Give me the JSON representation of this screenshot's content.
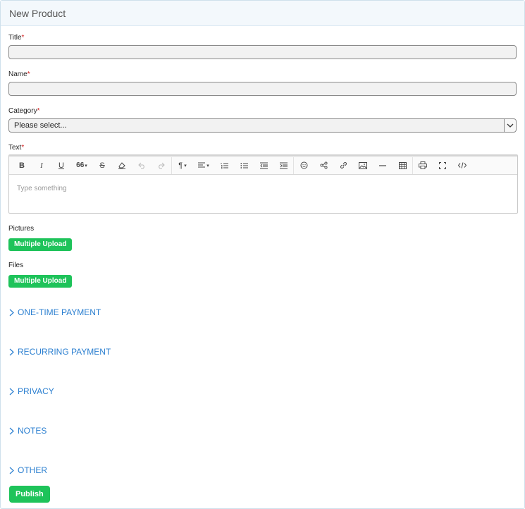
{
  "header": {
    "title": "New Product"
  },
  "fields": {
    "title": {
      "label": "Title",
      "required": "*",
      "value": ""
    },
    "name": {
      "label": "Name",
      "required": "*",
      "value": ""
    },
    "category": {
      "label": "Category",
      "required": "*",
      "selected": "Please select..."
    },
    "text": {
      "label": "Text",
      "required": "*",
      "placeholder": "Type something"
    }
  },
  "toolbar": {
    "buttons": [
      "bold-icon",
      "italic-icon",
      "underline-icon",
      "quote-icon",
      "strikethrough-icon",
      "eraser-icon",
      "undo-icon",
      "redo-icon",
      "paragraph-icon",
      "align-icon",
      "ordered-list-icon",
      "unordered-list-icon",
      "outdent-icon",
      "indent-icon",
      "emoji-icon",
      "share-icon",
      "link-icon",
      "image-icon",
      "horizontal-rule-icon",
      "table-icon",
      "print-icon",
      "fullscreen-icon",
      "code-icon"
    ],
    "glyphs": {
      "bold": "B",
      "italic": "I",
      "underline": "U",
      "quote": "66",
      "strike": "S"
    }
  },
  "pictures": {
    "label": "Pictures",
    "button": "Multiple Upload"
  },
  "files": {
    "label": "Files",
    "button": "Multiple Upload"
  },
  "sections": [
    {
      "label": "ONE-TIME PAYMENT"
    },
    {
      "label": "RECURRING PAYMENT"
    },
    {
      "label": "PRIVACY"
    },
    {
      "label": "NOTES"
    },
    {
      "label": "OTHER"
    }
  ],
  "actions": {
    "publish": "Publish"
  },
  "colors": {
    "accent_green": "#1ec35a",
    "link_blue": "#2b7fd0",
    "required_red": "#d01e1e"
  }
}
